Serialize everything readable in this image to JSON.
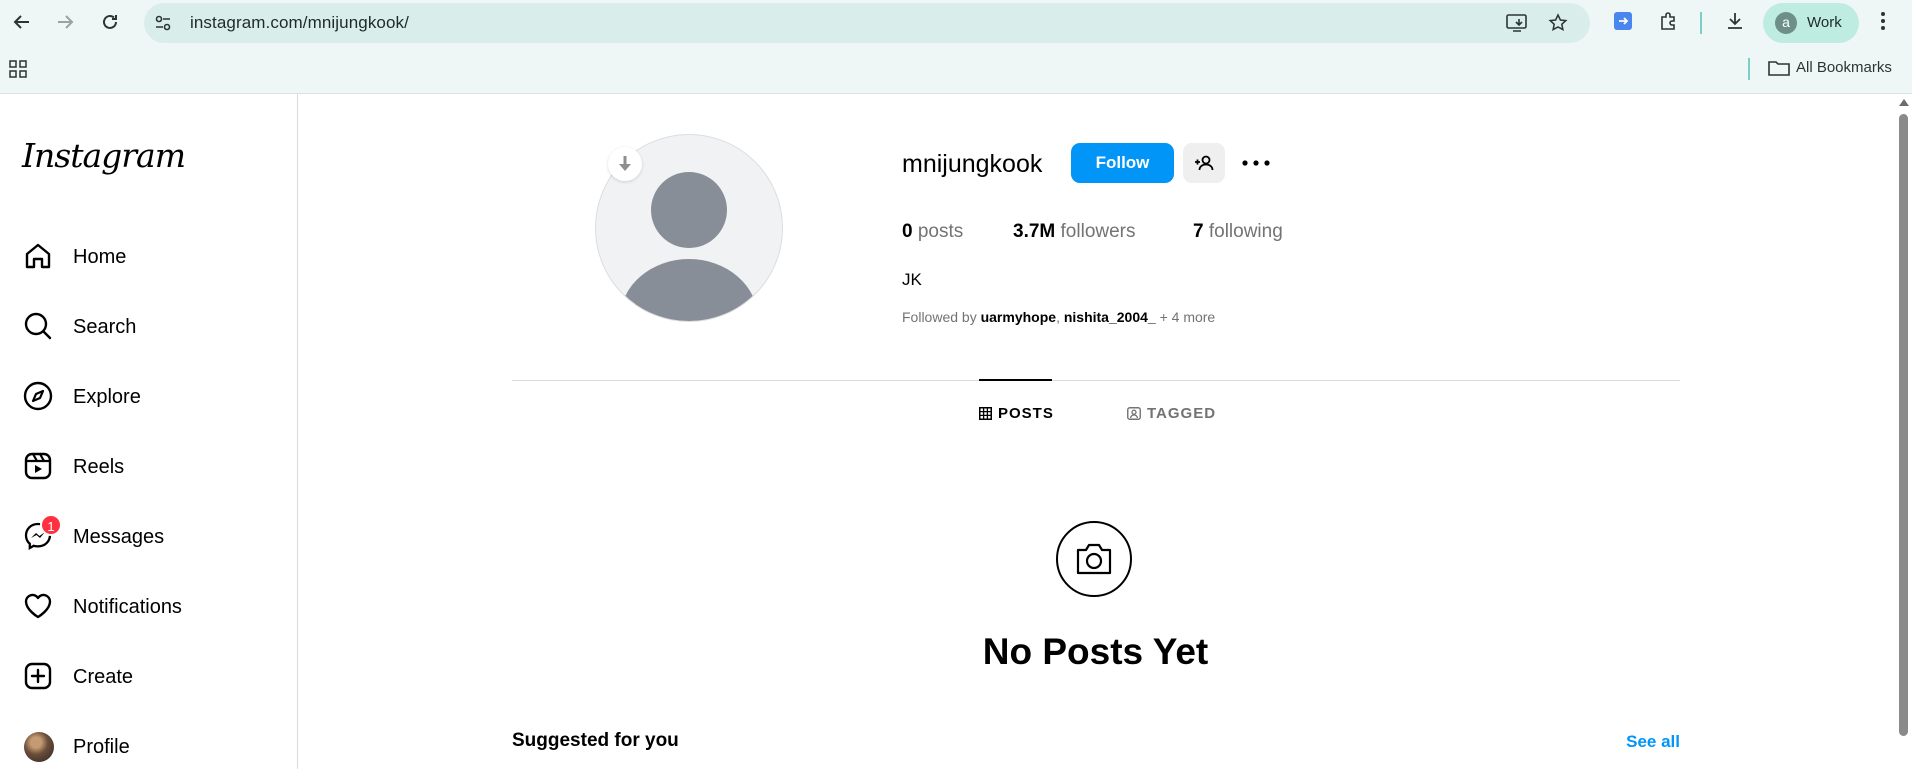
{
  "browser": {
    "url": "instagram.com/mnijungkook/",
    "profile_label": "Work",
    "profile_initial": "a",
    "bookmarks_label": "All Bookmarks"
  },
  "sidebar": {
    "logo": "Instagram",
    "items": [
      {
        "label": "Home",
        "icon": "home-icon"
      },
      {
        "label": "Search",
        "icon": "search-icon"
      },
      {
        "label": "Explore",
        "icon": "compass-icon"
      },
      {
        "label": "Reels",
        "icon": "reels-icon"
      },
      {
        "label": "Messages",
        "icon": "messenger-icon",
        "badge": "1"
      },
      {
        "label": "Notifications",
        "icon": "heart-icon"
      },
      {
        "label": "Create",
        "icon": "plus-square-icon"
      },
      {
        "label": "Profile",
        "icon": "profile-avatar"
      }
    ]
  },
  "profile": {
    "username": "mnijungkook",
    "follow_label": "Follow",
    "posts_count": "0",
    "posts_label": "posts",
    "followers_count": "3.7M",
    "followers_label": "followers",
    "following_count": "7",
    "following_label": "following",
    "full_name": "JK",
    "followed_by_prefix": "Followed by",
    "followed_by_user1": "uarmyhope",
    "followed_by_user2": "nishita_2004_",
    "followed_by_more": "+ 4 more"
  },
  "tabs": {
    "posts": "POSTS",
    "tagged": "TAGGED"
  },
  "empty_state": {
    "title": "No Posts Yet"
  },
  "suggested": {
    "title": "Suggested for you",
    "see_all": "See all"
  },
  "colors": {
    "accent": "#0095f6",
    "badge": "#ff3040",
    "chrome_bg": "#eef7f5"
  }
}
